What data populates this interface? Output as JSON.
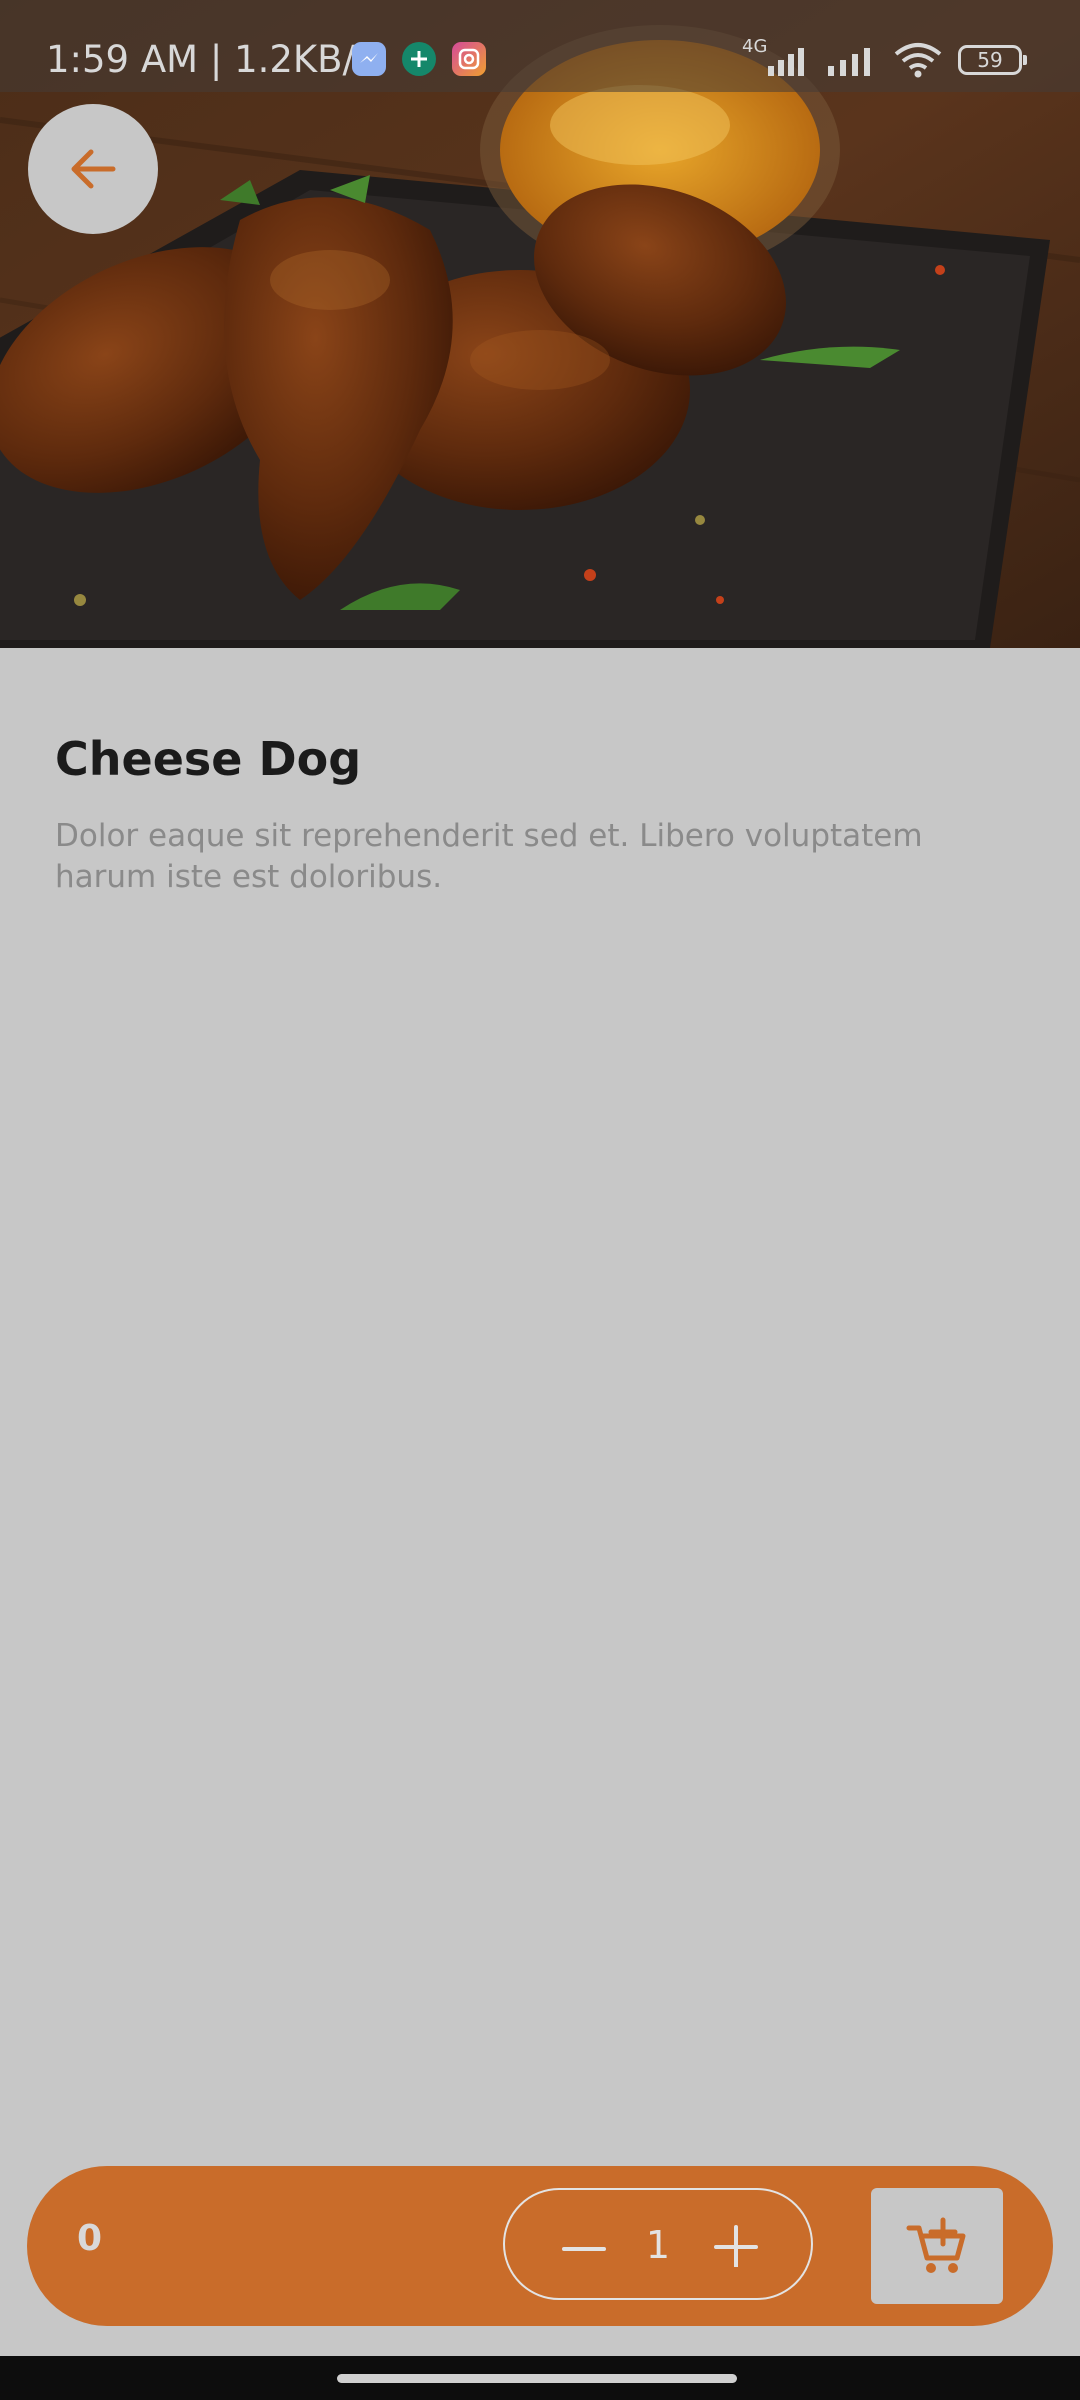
{
  "status_bar": {
    "time_speed": "1:59 AM | 1.2KB/s",
    "network": "4G",
    "battery": "59",
    "app_icons": [
      "messenger-icon",
      "chat-plus-icon",
      "instagram-icon"
    ]
  },
  "product": {
    "name": "Cheese Dog",
    "description": "Dolor eaque sit reprehenderit sed et. Libero voluptatem harum iste est doloribus."
  },
  "cart": {
    "total": "0",
    "quantity": "1",
    "decrement_icon": "minus-icon",
    "increment_icon": "plus-icon",
    "add_icon": "cart-plus-icon"
  },
  "colors": {
    "accent": "#c96c2a",
    "page_background": "#c7c7c7",
    "title_text": "#1b1b1b",
    "description_text": "#8a8a8a"
  }
}
